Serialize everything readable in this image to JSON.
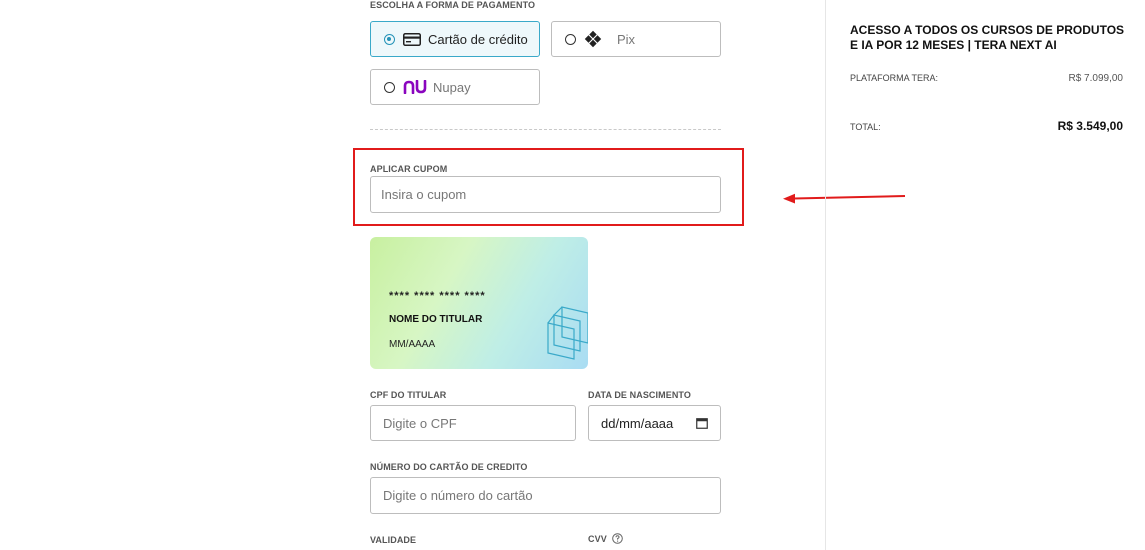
{
  "payment": {
    "section_label": "ESCOLHA A FORMA DE PAGAMENTO",
    "options": [
      {
        "label": "Cartão de crédito",
        "selected": true,
        "icon": "credit-card-icon"
      },
      {
        "label": "Pix",
        "selected": false,
        "icon": "pix-icon"
      },
      {
        "label": "Nupay",
        "selected": false,
        "icon": "nubank-logo-icon"
      }
    ]
  },
  "coupon": {
    "label": "APLICAR CUPOM",
    "placeholder": "Insira o cupom"
  },
  "card_preview": {
    "number_mask": "**** **** **** ****",
    "holder": "NOME DO TITULAR",
    "expiry": "MM/AAAA"
  },
  "form": {
    "cpf_label": "CPF DO TITULAR",
    "cpf_placeholder": "Digite o CPF",
    "birth_label": "DATA DE NASCIMENTO",
    "birth_placeholder": "dd/mm/aaaa",
    "card_number_label": "NÚMERO DO CARTÃO DE CREDITO",
    "card_number_placeholder": "Digite o número do cartão",
    "expiry_label": "VALIDADE",
    "cvv_label": "CVV"
  },
  "summary": {
    "product_title": "ACESSO A TODOS OS CURSOS DE PRODUTOS E IA POR 12 MESES | TERA NEXT AI",
    "platform_label": "PLATAFORMA TERA:",
    "platform_price": "R$ 7.099,00",
    "total_label": "TOTAL:",
    "total_price": "R$ 3.549,00"
  },
  "annotation": {
    "highlight_color": "#e11b1b"
  }
}
